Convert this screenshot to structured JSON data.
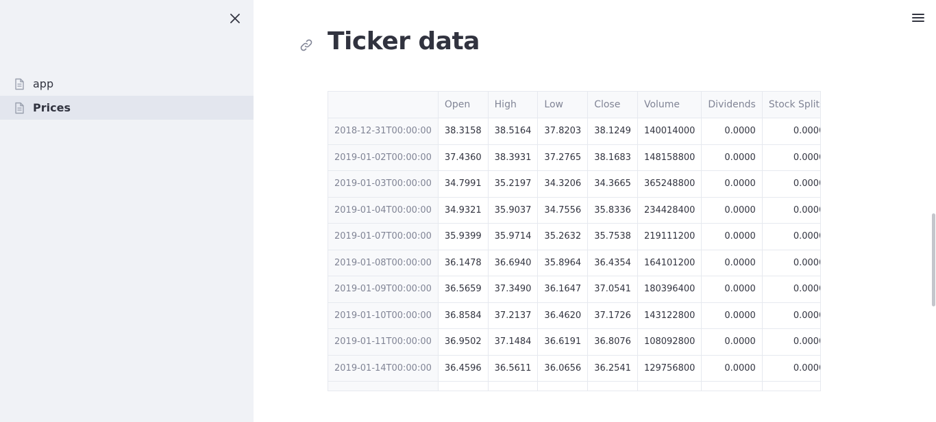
{
  "sidebar": {
    "close_label": "×",
    "items": [
      {
        "label": "app",
        "icon": "document-icon",
        "active": false
      },
      {
        "label": "Prices",
        "icon": "document-icon",
        "active": true
      }
    ]
  },
  "main": {
    "title": "Ticker data",
    "table": {
      "columns": [
        "",
        "Open",
        "High",
        "Low",
        "Close",
        "Volume",
        "Dividends",
        "Stock Splits"
      ],
      "rows": [
        [
          "2018-12-31T00:00:00",
          "38.3158",
          "38.5164",
          "37.8203",
          "38.1249",
          "140014000",
          "0.0000",
          "0.0000"
        ],
        [
          "2019-01-02T00:00:00",
          "37.4360",
          "38.3931",
          "37.2765",
          "38.1683",
          "148158800",
          "0.0000",
          "0.0000"
        ],
        [
          "2019-01-03T00:00:00",
          "34.7991",
          "35.2197",
          "34.3206",
          "34.3665",
          "365248800",
          "0.0000",
          "0.0000"
        ],
        [
          "2019-01-04T00:00:00",
          "34.9321",
          "35.9037",
          "34.7556",
          "35.8336",
          "234428400",
          "0.0000",
          "0.0000"
        ],
        [
          "2019-01-07T00:00:00",
          "35.9399",
          "35.9714",
          "35.2632",
          "35.7538",
          "219111200",
          "0.0000",
          "0.0000"
        ],
        [
          "2019-01-08T00:00:00",
          "36.1478",
          "36.6940",
          "35.8964",
          "36.4354",
          "164101200",
          "0.0000",
          "0.0000"
        ],
        [
          "2019-01-09T00:00:00",
          "36.5659",
          "37.3490",
          "36.1647",
          "37.0541",
          "180396400",
          "0.0000",
          "0.0000"
        ],
        [
          "2019-01-10T00:00:00",
          "36.8584",
          "37.2137",
          "36.4620",
          "37.1726",
          "143122800",
          "0.0000",
          "0.0000"
        ],
        [
          "2019-01-11T00:00:00",
          "36.9502",
          "37.1484",
          "36.6191",
          "36.8076",
          "108092800",
          "0.0000",
          "0.0000"
        ],
        [
          "2019-01-14T00:00:00",
          "36.4596",
          "36.5611",
          "36.0656",
          "36.2541",
          "129756800",
          "0.0000",
          "0.0000"
        ],
        [
          "",
          "",
          "",
          "",
          "",
          "",
          "",
          ""
        ]
      ]
    }
  },
  "colors": {
    "sidebar_bg": "#f0f2f6",
    "active_item_bg": "#e3e6ee",
    "text": "#31333f",
    "muted": "#808495"
  }
}
